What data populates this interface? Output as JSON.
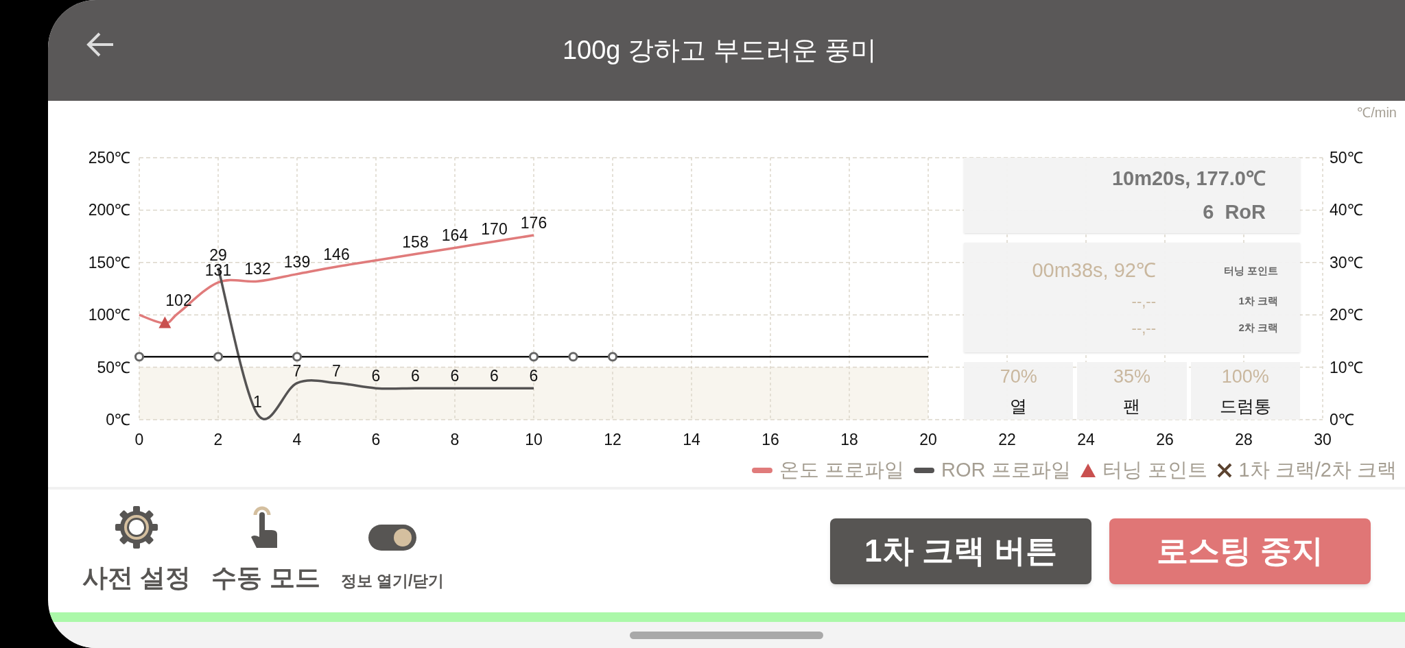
{
  "header": {
    "title": "100g 강하고 부드러운 풍미"
  },
  "chart": {
    "chart_data": {
      "type": "line",
      "grid": true,
      "x": [
        0,
        0.65,
        1,
        2,
        3,
        4,
        5,
        6,
        7,
        8,
        9,
        10,
        11,
        12,
        20
      ],
      "bands": [
        {
          "axis": "y",
          "from": 0,
          "to": 50,
          "color": "#f8f5ee"
        }
      ],
      "xlim": [
        0,
        30
      ],
      "ylim": [
        0,
        250
      ],
      "xticks": [
        0,
        2,
        4,
        6,
        8,
        10,
        12,
        14,
        16,
        18,
        20,
        22,
        24,
        26,
        28,
        30
      ],
      "yticks": [
        {
          "value": 0,
          "label": "0℃"
        },
        {
          "value": 50,
          "label": "50℃"
        },
        {
          "value": 100,
          "label": "100℃"
        },
        {
          "value": 150,
          "label": "150℃"
        },
        {
          "value": 200,
          "label": "200℃"
        },
        {
          "value": 250,
          "label": "250℃"
        }
      ],
      "y2label": "℃/min",
      "y2lim": [
        0,
        50
      ],
      "y2ticks": [
        {
          "value": 0,
          "label": "0℃"
        },
        {
          "value": 10,
          "label": "10℃"
        },
        {
          "value": 20,
          "label": "20℃"
        },
        {
          "value": 30,
          "label": "30℃"
        },
        {
          "value": 40,
          "label": "40℃"
        },
        {
          "value": 50,
          "label": "50℃"
        }
      ],
      "data_labels": "value_labels",
      "series": [
        {
          "name": "온도 프로파일",
          "color": "#e07b7b",
          "values": [
            100,
            92,
            102,
            131,
            132,
            139,
            146,
            152,
            158,
            164,
            170,
            176,
            null,
            null,
            null
          ],
          "value_labels": [
            null,
            null,
            "102",
            "131",
            "132",
            "139",
            "146",
            null,
            "158",
            "164",
            "170",
            "176",
            null,
            null,
            null
          ]
        },
        {
          "name": "ROR 프로파일",
          "color": "#555353",
          "axis": "y2",
          "values": [
            null,
            null,
            null,
            29,
            1,
            7,
            7,
            6,
            6,
            6,
            6,
            6,
            null,
            null,
            null
          ],
          "value_labels": [
            null,
            null,
            null,
            "29",
            "1",
            "7",
            "7",
            "6",
            "6",
            "6",
            "6",
            "6",
            null,
            null,
            null
          ]
        },
        {
          "color": "#111111",
          "marker": "circle",
          "values": [
            60,
            null,
            null,
            60,
            null,
            60,
            null,
            null,
            null,
            null,
            null,
            60,
            60,
            60,
            60
          ]
        }
      ]
    }
  },
  "info": {
    "current": "10m20s, 177.0℃",
    "ror": "6  RoR",
    "events": [
      {
        "value": "00m38s, 92℃",
        "label": "터닝 포인트",
        "kind": "main"
      },
      {
        "value": "--,--",
        "label": "1차 크랙",
        "kind": "pending"
      },
      {
        "value": "--,--",
        "label": "2차 크랙",
        "kind": "pending"
      }
    ],
    "levels": [
      {
        "value": "70%",
        "label": "열"
      },
      {
        "value": "35%",
        "label": "팬"
      },
      {
        "value": "100%",
        "label": "드럼통"
      }
    ]
  },
  "legend": [
    {
      "kind": "triangle",
      "label": "터닝 포인트",
      "color": "#c9504f"
    },
    {
      "kind": "cross",
      "label": "1차 크랙/2차 크랙",
      "color": "#5b4330"
    }
  ],
  "tools": [
    {
      "kind": "gear",
      "label": "사전 설정"
    },
    {
      "kind": "hand",
      "label": "수동 모드"
    },
    {
      "kind": "toggle",
      "label": "정보 열기/닫기",
      "on": true
    }
  ],
  "buttons": [
    {
      "kind": "dark",
      "label": "1차 크랙 버튼"
    },
    {
      "kind": "danger",
      "label": "로스팅 중지"
    }
  ],
  "progress": {
    "level": 1
  }
}
